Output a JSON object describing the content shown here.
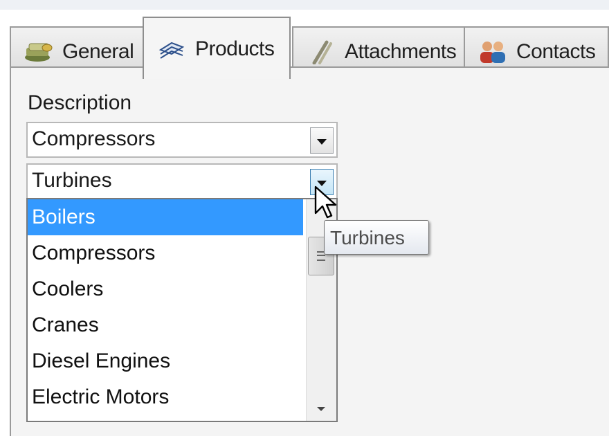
{
  "tabs": [
    {
      "label": "General",
      "icon": "money-stack-icon",
      "active": false
    },
    {
      "label": "Products",
      "icon": "products-arrows-icon",
      "active": true
    },
    {
      "label": "Attachments",
      "icon": "paperclip-icon",
      "active": false
    },
    {
      "label": "Contacts",
      "icon": "people-icon",
      "active": false
    }
  ],
  "form": {
    "description_label": "Description",
    "combo1_value": "Compressors",
    "combo2_value": "Turbines"
  },
  "dropdown": {
    "items": [
      "Boilers",
      "Compressors",
      "Coolers",
      "Cranes",
      "Diesel Engines",
      "Electric Motors"
    ],
    "selected": "Boilers"
  },
  "tooltip": {
    "text": "Turbines"
  },
  "colors": {
    "selection": "#3399ff",
    "panel_bg": "#f4f4f4"
  }
}
